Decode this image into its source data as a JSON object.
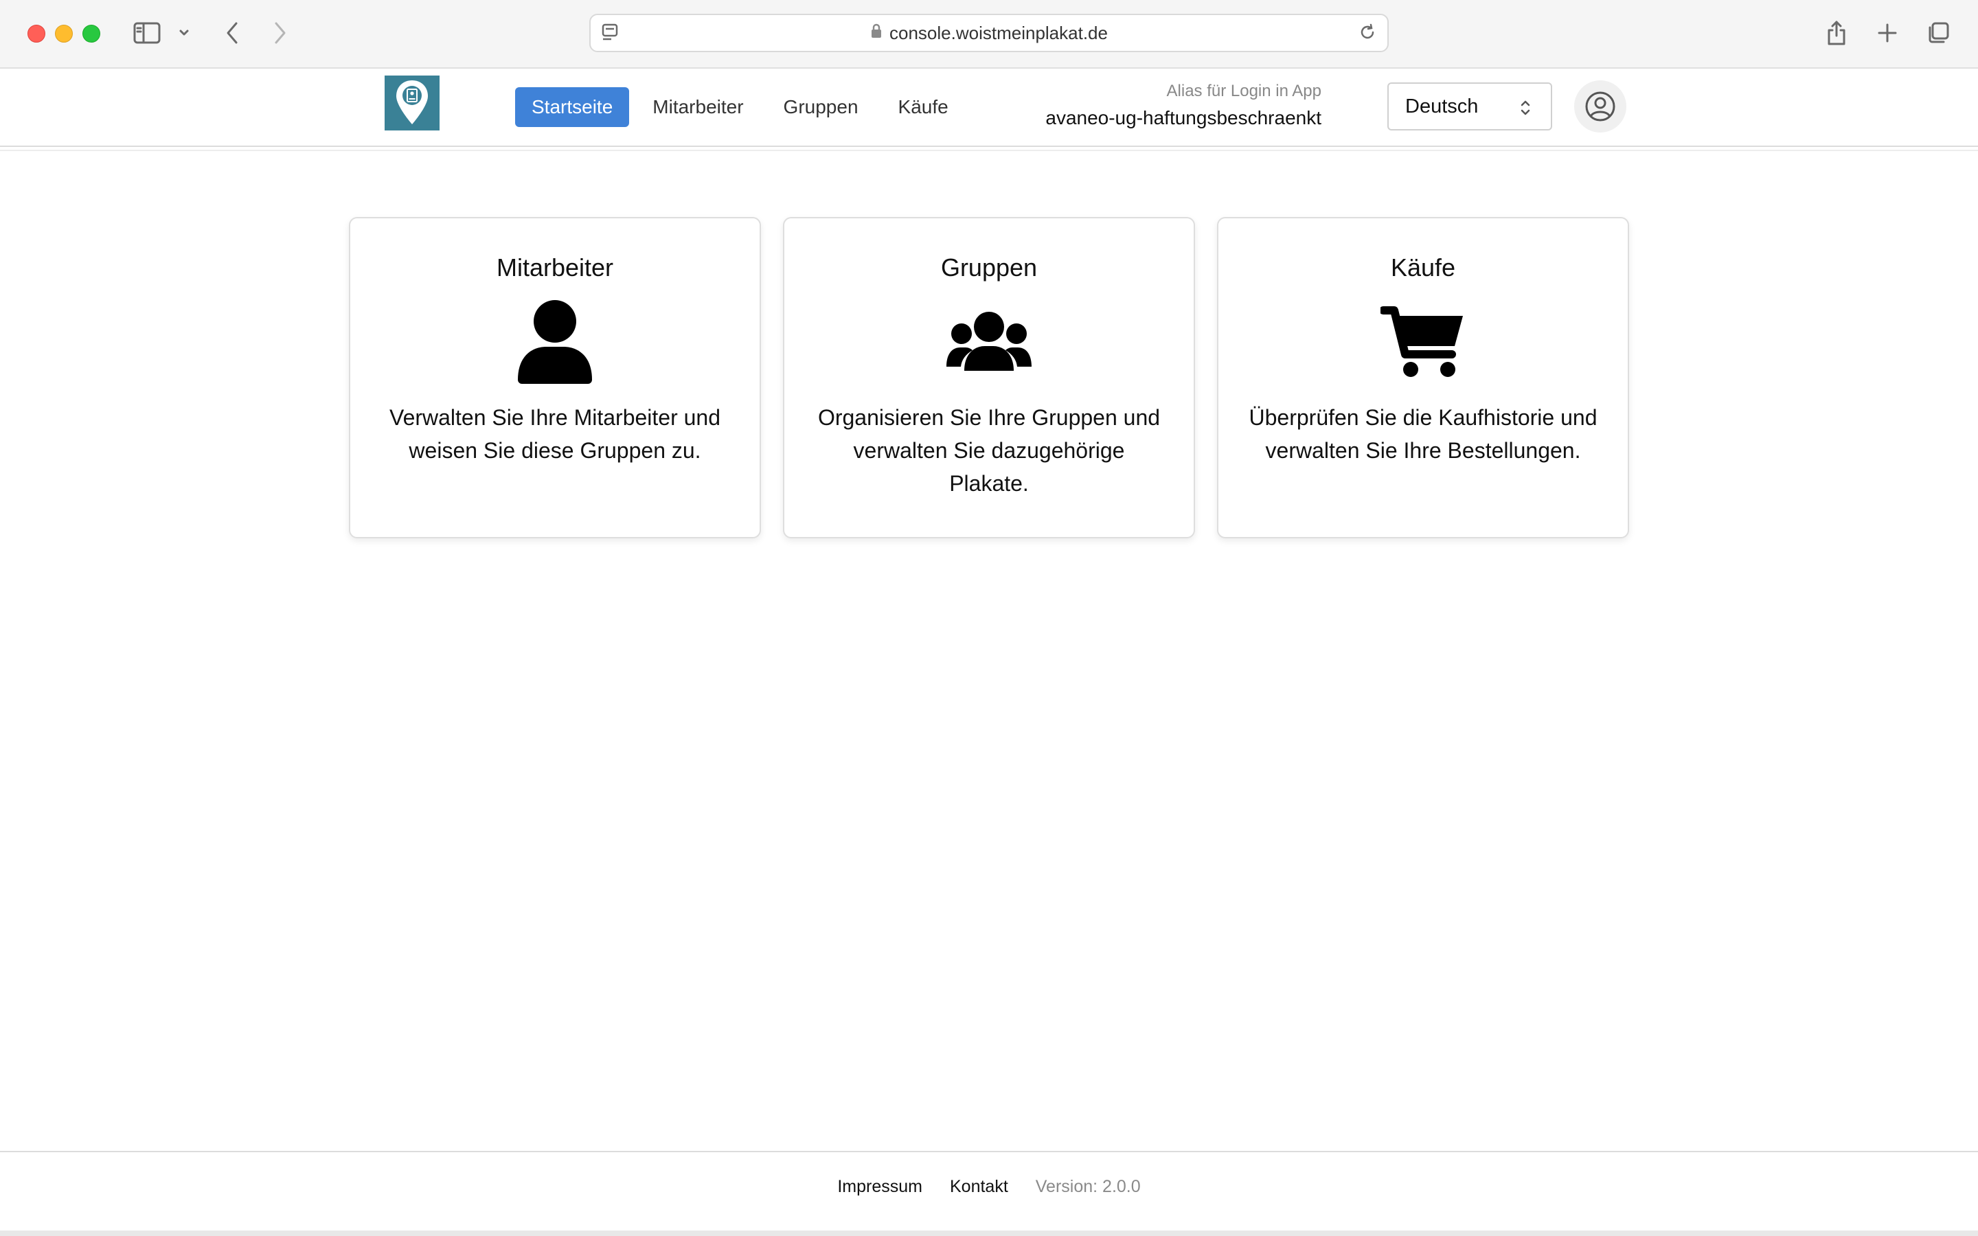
{
  "browser": {
    "url": "console.woistmeinplakat.de"
  },
  "nav": {
    "items": [
      {
        "label": "Startseite",
        "active": true
      },
      {
        "label": "Mitarbeiter",
        "active": false
      },
      {
        "label": "Gruppen",
        "active": false
      },
      {
        "label": "Käufe",
        "active": false
      }
    ]
  },
  "alias": {
    "label": "Alias für Login in App",
    "value": "avaneo-ug-haftungsbeschraenkt"
  },
  "language": {
    "selected": "Deutsch"
  },
  "cards": [
    {
      "title": "Mitarbeiter",
      "icon": "user-icon",
      "text": "Verwalten Sie Ihre Mitarbeiter und weisen Sie diese Gruppen zu."
    },
    {
      "title": "Gruppen",
      "icon": "users-group-icon",
      "text": "Organisieren Sie Ihre Gruppen und verwalten Sie dazugehörige Plakate."
    },
    {
      "title": "Käufe",
      "icon": "shopping-cart-icon",
      "text": "Überprüfen Sie die Kaufhistorie und verwalten Sie Ihre Bestellungen."
    }
  ],
  "footer": {
    "impressum": "Impressum",
    "kontakt": "Kontakt",
    "version": "Version: 2.0.0"
  },
  "colors": {
    "accent": "#3f82d8",
    "logo_bg": "#3a8196"
  }
}
